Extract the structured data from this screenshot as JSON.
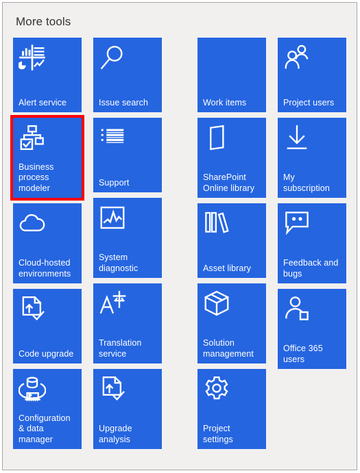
{
  "header": {
    "title": "More tools"
  },
  "theme": {
    "tile_color": "#2565e0",
    "tile_text_color": "#ffffff",
    "panel_background": "#f1f0ef",
    "panel_border": "#a6a6a6",
    "selection_highlight": "#ff0000",
    "title_color": "#333333"
  },
  "columns": [
    {
      "name": "column-1",
      "tiles": [
        {
          "label": "Alert service",
          "icon": "analytics-dashboard-icon",
          "selected": false
        },
        {
          "label": "Business process modeler",
          "icon": "process-hierarchy-check-icon",
          "selected": true
        },
        {
          "label": "Cloud-hosted environments",
          "icon": "cloud-icon",
          "selected": false
        },
        {
          "label": "Code upgrade",
          "icon": "document-upload-check-icon",
          "selected": false
        },
        {
          "label": "Configuration & data manager",
          "icon": "data-transfer-icon",
          "selected": false
        }
      ]
    },
    {
      "name": "column-2",
      "tiles": [
        {
          "label": "Issue search",
          "icon": "magnifier-icon",
          "selected": false
        },
        {
          "label": "Support",
          "icon": "list-lines-icon",
          "selected": false
        },
        {
          "label": "System diagnostic",
          "icon": "chart-framed-icon",
          "selected": false
        },
        {
          "label": "Translation service",
          "icon": "translate-a-character-icon",
          "selected": false
        },
        {
          "label": "Upgrade analysis",
          "icon": "document-upload-check-icon",
          "selected": false
        }
      ]
    },
    {
      "name": "column-3",
      "tiles": [
        {
          "label": "Work items",
          "icon": "none",
          "selected": false
        },
        {
          "label": "SharePoint Online library",
          "icon": "document-outline-icon",
          "selected": false
        },
        {
          "label": "Asset library",
          "icon": "books-icon",
          "selected": false
        },
        {
          "label": "Solution management",
          "icon": "box-package-icon",
          "selected": false
        },
        {
          "label": "Project settings",
          "icon": "gear-icon",
          "selected": false
        }
      ]
    },
    {
      "name": "column-4",
      "tiles": [
        {
          "label": "Project users",
          "icon": "people-group-icon",
          "selected": false
        },
        {
          "label": "My subscription",
          "icon": "download-arrow-icon",
          "selected": false
        },
        {
          "label": "Feedback and bugs",
          "icon": "speech-bubble-icon",
          "selected": false
        },
        {
          "label": "Office 365 users",
          "icon": "person-square-icon",
          "selected": false
        }
      ]
    }
  ]
}
